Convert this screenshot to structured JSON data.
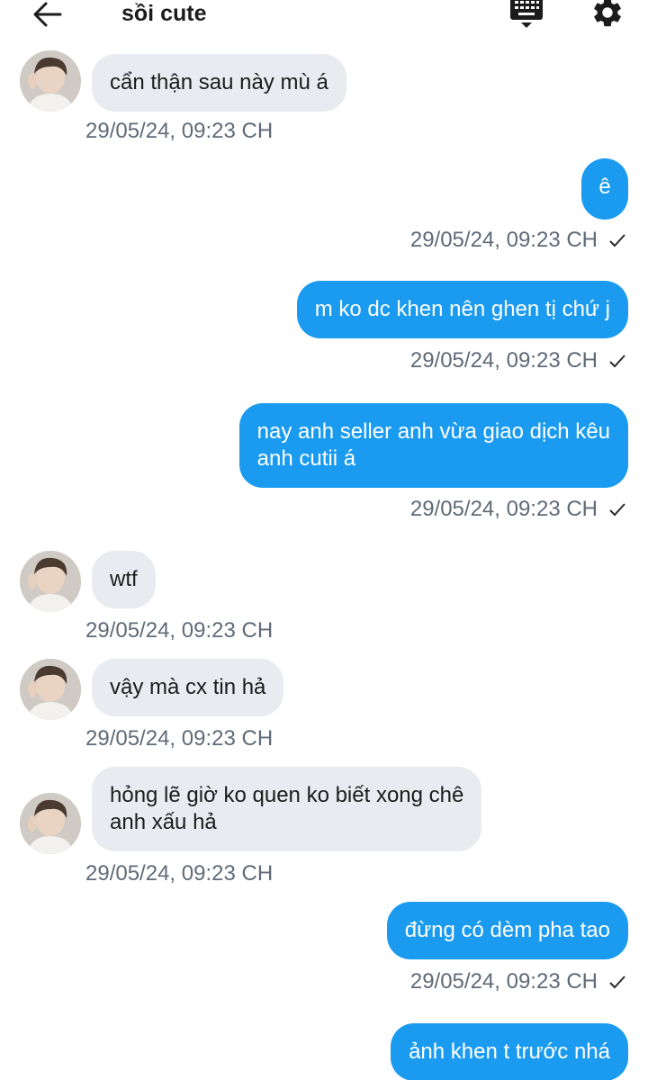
{
  "header": {
    "title": "sồi cute",
    "back_icon": "arrow-left-icon",
    "keyboard_icon": "keyboard-icon",
    "settings_icon": "gear-icon"
  },
  "colors": {
    "outgoing_bubble": "#1a9bf0",
    "incoming_bubble": "#e8ebef",
    "timestamp": "#5f6b78"
  },
  "messages": [
    {
      "direction": "in",
      "text": "cẩn thận sau này mù á",
      "time": "29/05/24, 09:23 CH"
    },
    {
      "direction": "out",
      "text": "ê",
      "time": "29/05/24, 09:23 CH",
      "status": "sent"
    },
    {
      "direction": "out",
      "text": "m ko dc khen nên ghen tị chứ j",
      "time": "29/05/24, 09:23 CH",
      "status": "sent"
    },
    {
      "direction": "out",
      "text": "nay anh seller anh vừa giao dịch kêu\nanh cutii á",
      "time": "29/05/24, 09:23 CH",
      "status": "sent"
    },
    {
      "direction": "in",
      "text": "wtf",
      "time": "29/05/24, 09:23 CH"
    },
    {
      "direction": "in",
      "text": "vậy mà cx tin hả",
      "time": "29/05/24, 09:23 CH"
    },
    {
      "direction": "in",
      "text": "hỏng lẽ giờ ko quen ko biết xong chê\nanh xấu hả",
      "time": "29/05/24, 09:23 CH"
    },
    {
      "direction": "out",
      "text": "đừng có dèm pha tao",
      "time": "29/05/24, 09:23 CH",
      "status": "sent"
    },
    {
      "direction": "out",
      "text": "ảnh khen t trước nhá"
    }
  ]
}
